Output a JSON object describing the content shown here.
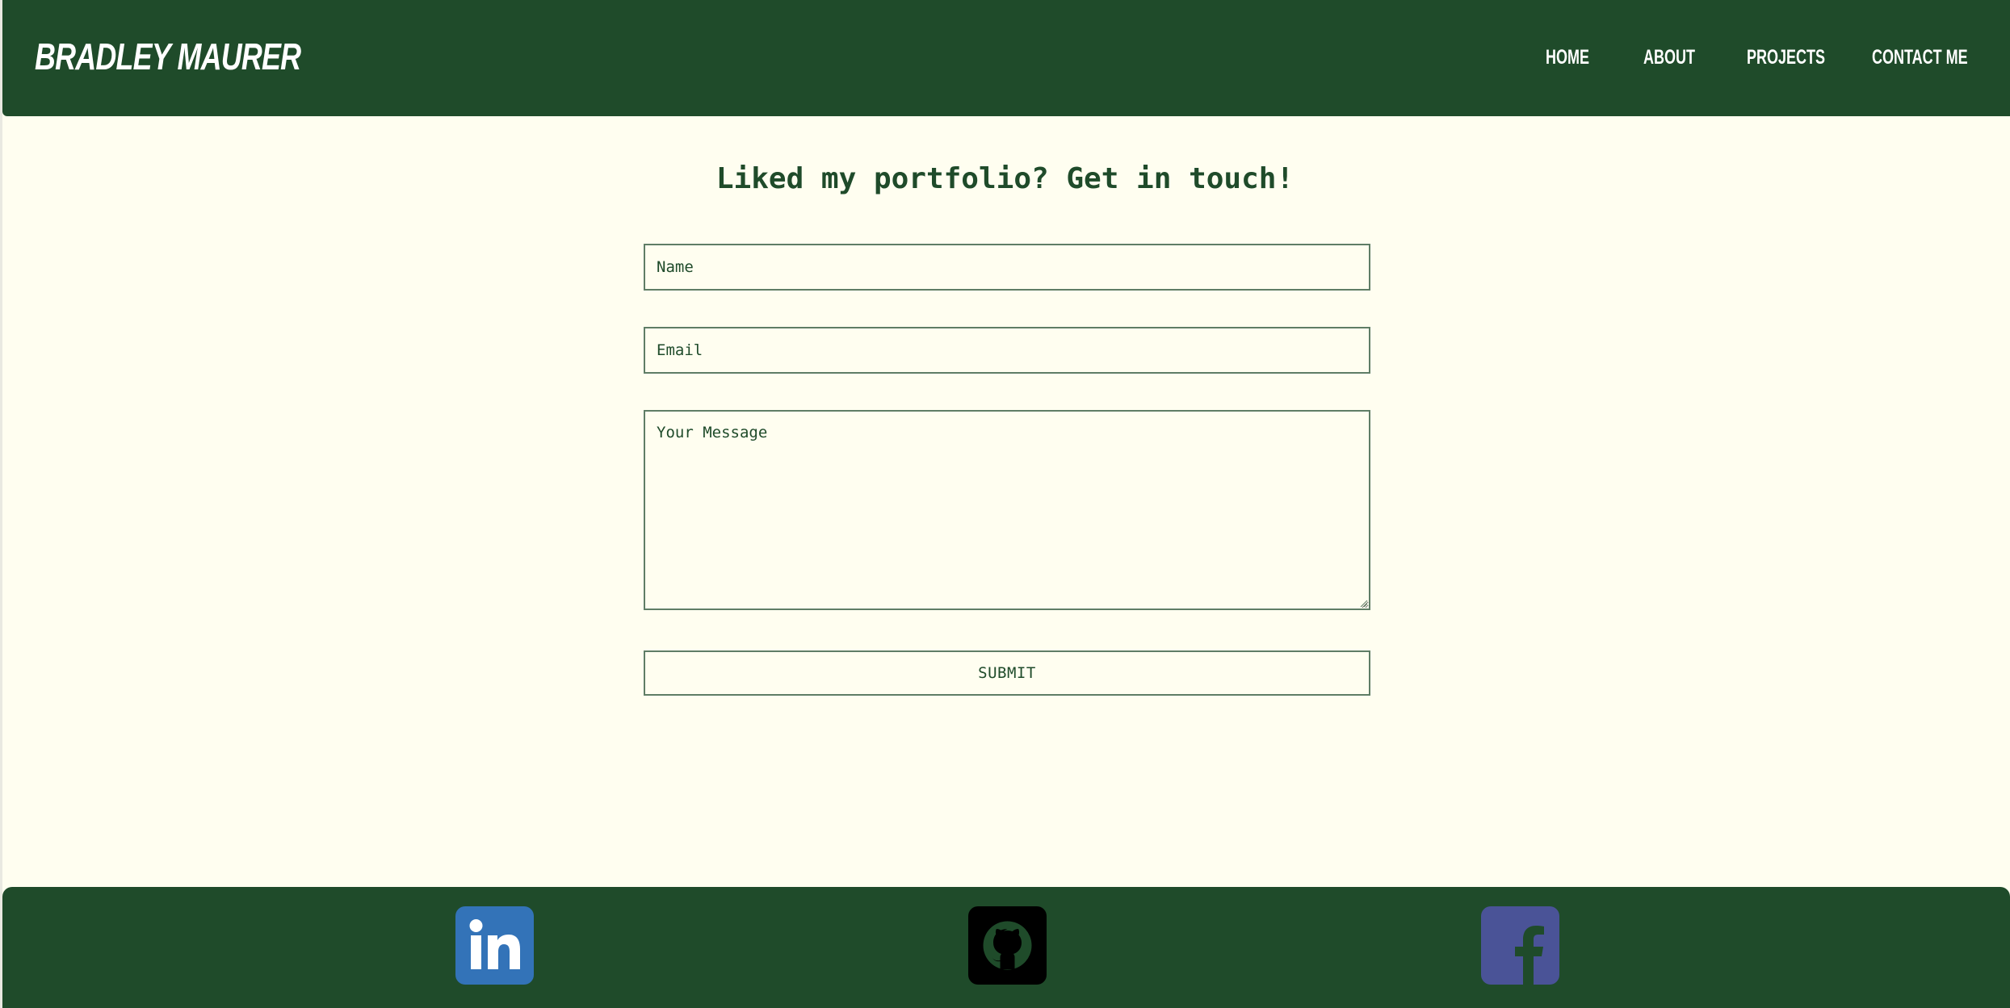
{
  "header": {
    "brand": "BRADLEY MAURER",
    "nav": {
      "home": "HOME",
      "about": "ABOUT",
      "projects": "PROJECTS",
      "contact": "CONTACT ME"
    }
  },
  "main": {
    "heading": "Liked my portfolio? Get in touch!",
    "form": {
      "name_placeholder": "Name",
      "name_value": "",
      "email_placeholder": "Email",
      "email_value": "",
      "message_placeholder": "Your Message",
      "message_value": "",
      "submit_label": "SUBMIT"
    }
  },
  "footer": {
    "social": [
      {
        "icon": "linkedin-icon",
        "color": "#3373b8"
      },
      {
        "icon": "github-icon",
        "color": "#000000"
      },
      {
        "icon": "facebook-icon",
        "color": "#4a5397"
      }
    ]
  },
  "colors": {
    "primary_green": "#1f4b2a",
    "background_cream": "#fffef0",
    "field_border": "#5f7d66",
    "text_white": "#ffffff"
  }
}
